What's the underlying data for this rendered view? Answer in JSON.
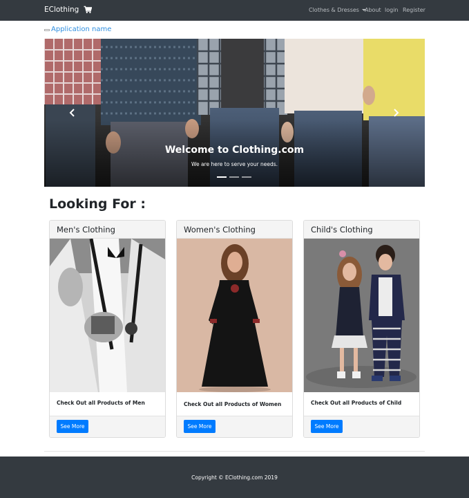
{
  "navbar": {
    "brand": "EClothing",
    "cart_icon": "shopping-cart-icon",
    "links": {
      "clothes": "Clothes & Dresses",
      "about": "About",
      "login": "login",
      "register": "Register"
    }
  },
  "app_name": "Application name",
  "carousel": {
    "title": "Welcome to Clothing.com",
    "subtitle": "We are here to serve your needs.",
    "slide_count": 3,
    "active_slide": 1
  },
  "section_title": "Looking For :",
  "cards": [
    {
      "title": "Men's Clothing",
      "text": "Check Out all Products of Men",
      "button": "See More"
    },
    {
      "title": "Women's Clothing",
      "text": "Check Out all Products of Women",
      "button": "See More"
    },
    {
      "title": "Child's Clothing",
      "text": "Check Out all Products of Child",
      "button": "See More"
    }
  ],
  "footer": {
    "copyright": "Copyright © EClothing.com 2019"
  },
  "colors": {
    "navbar": "#343a40",
    "link": "#2f8fe0",
    "button": "#007bff",
    "card_header": "#f4f4f4"
  }
}
